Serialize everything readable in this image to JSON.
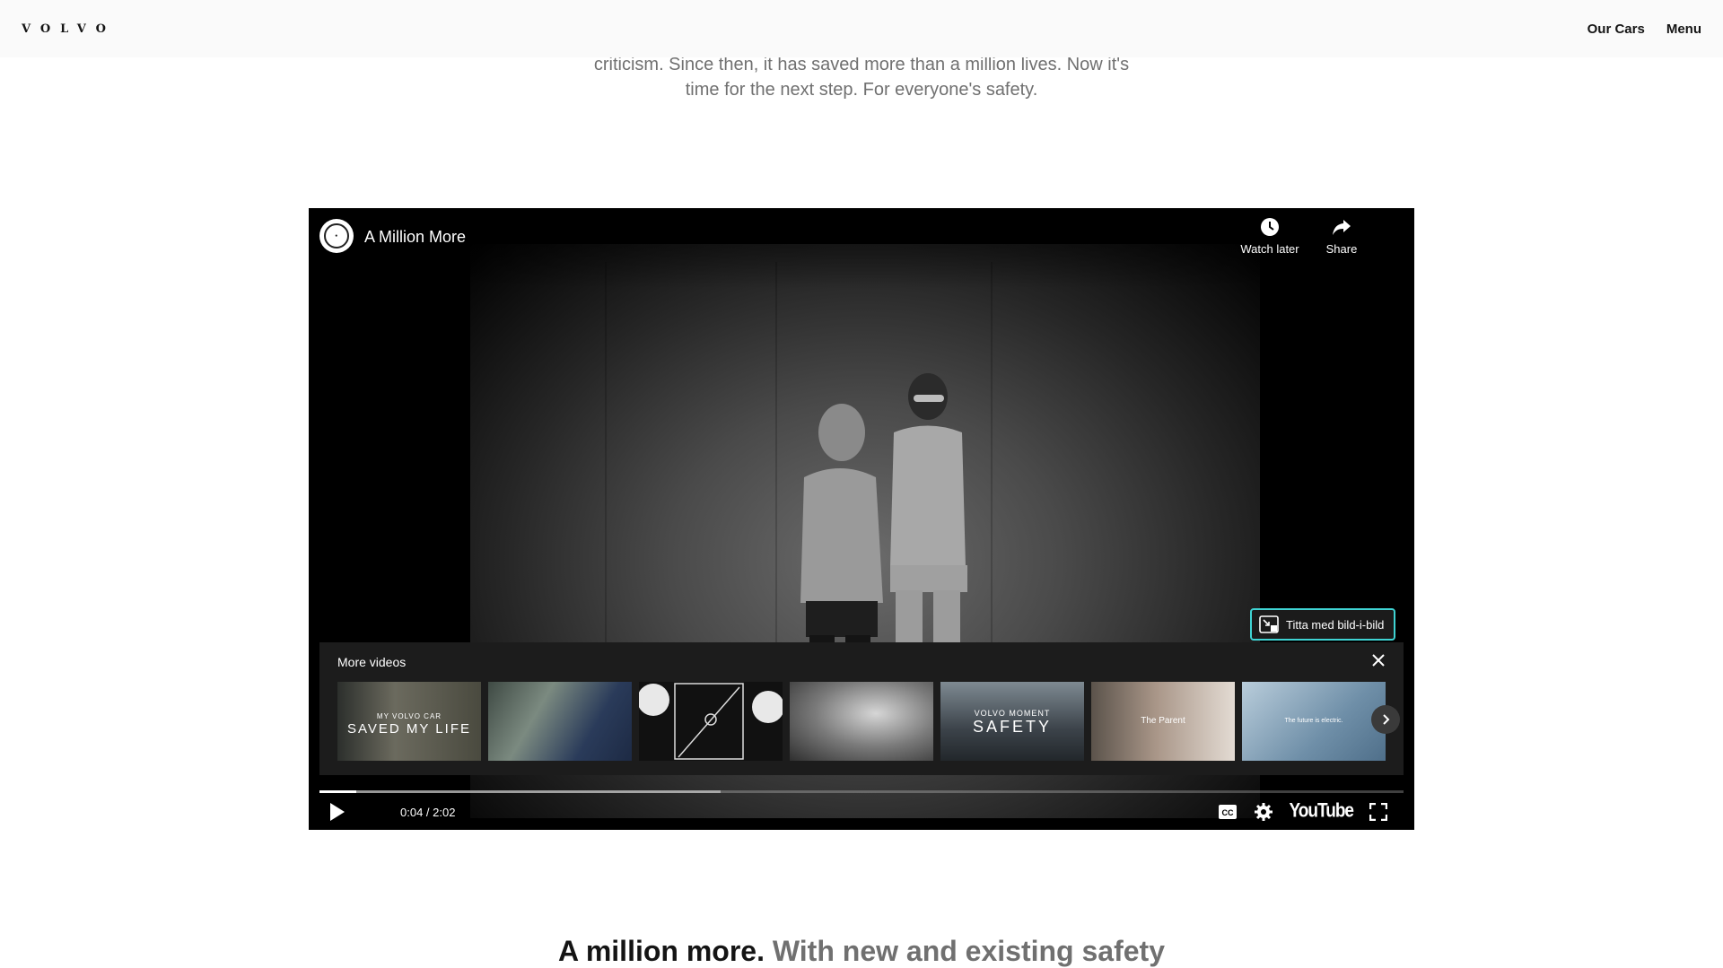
{
  "header": {
    "logo": "VOLVO",
    "nav": [
      "Our Cars",
      "Menu"
    ]
  },
  "intro": {
    "lines": [
      "criticism. Since then, it has saved more than a million lives. Now it's",
      "time for the next step. For everyone's safety."
    ]
  },
  "player": {
    "title": "A Million More",
    "watch_later": "Watch later",
    "share": "Share",
    "pip": "Titta med bild-i-bild",
    "more_videos": "More videos",
    "time": "0:04 / 2:02",
    "progress_played": 0.034,
    "progress_buffered": 0.37,
    "brand": "YouTube",
    "thumbnails": [
      {
        "caption_small": "MY VOLVO CAR",
        "caption_big": "SAVED MY LIFE"
      },
      {
        "caption_small": "",
        "caption_big": ""
      },
      {
        "caption_small": "",
        "caption_big": ""
      },
      {
        "caption_small": "",
        "caption_big": ""
      },
      {
        "caption_small": "VOLVO MOMENT",
        "caption_big": "SAFETY"
      },
      {
        "caption_small": "",
        "caption_big": "The Parent"
      },
      {
        "caption_small": "",
        "caption_big": "The future is electric."
      }
    ],
    "icons": [
      "watch-later-icon",
      "share-icon",
      "pip-icon",
      "close-icon",
      "chevron-right-icon",
      "play-icon",
      "captions-icon",
      "settings-icon",
      "fullscreen-icon"
    ]
  },
  "headline": {
    "strong": "A million more.",
    "muted": "With new and existing safety"
  }
}
